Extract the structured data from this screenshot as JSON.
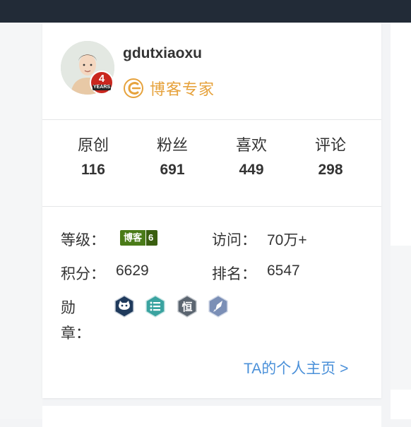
{
  "profile": {
    "username": "gdutxiaoxu",
    "years_badge": {
      "number": "4",
      "label": "YEARS"
    },
    "expert_label": "博客专家"
  },
  "stats": [
    {
      "label": "原创",
      "value": "116"
    },
    {
      "label": "粉丝",
      "value": "691"
    },
    {
      "label": "喜欢",
      "value": "449"
    },
    {
      "label": "评论",
      "value": "298"
    }
  ],
  "info": {
    "level_label": "等级：",
    "level_badge_text": "博客",
    "level_badge_num": "6",
    "visits_label": "访问：",
    "visits_value": "70万+",
    "points_label": "积分：",
    "points_value": "6629",
    "rank_label": "排名：",
    "rank_value": "6547",
    "medals_label_line1": "勋",
    "medals_label_line2": "章："
  },
  "medals": [
    {
      "icon": "github-cat-icon",
      "color": "#1f3a5c"
    },
    {
      "icon": "list-icon",
      "color": "#3aa3a0"
    },
    {
      "icon": "constant-heng-icon",
      "color": "#5b6570",
      "text": "恒"
    },
    {
      "icon": "rocket-icon",
      "color": "#7b8fb6"
    }
  ],
  "profile_link": "TA的个人主页 >",
  "colors": {
    "topbar": "#222b37",
    "expert": "#e6a23c",
    "link": "#4a90d9",
    "years_badge": "#c9271f",
    "level_badge": "#4a7b18"
  }
}
